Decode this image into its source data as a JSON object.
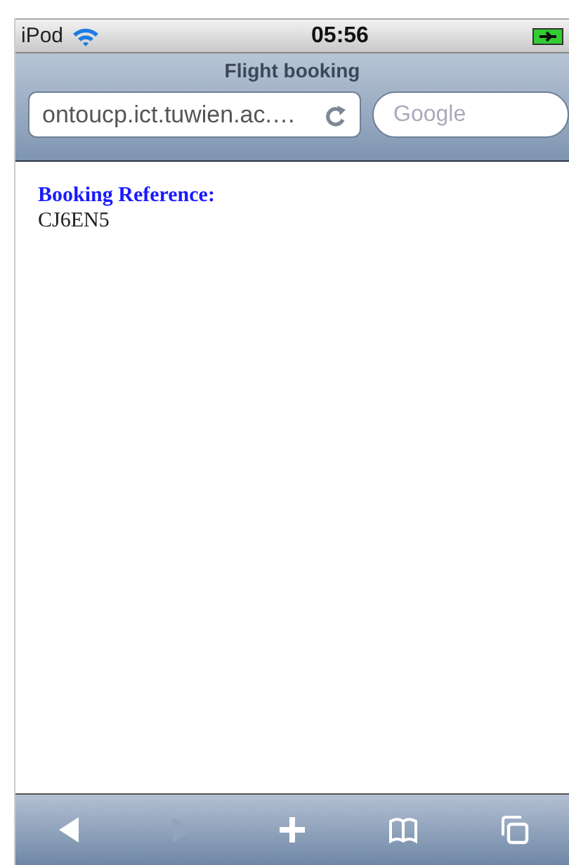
{
  "status_bar": {
    "carrier": "iPod",
    "time": "05:56"
  },
  "window": {
    "title": "Flight booking"
  },
  "address_field": {
    "value": "ontoucp.ict.tuwien.ac.…"
  },
  "search": {
    "placeholder": "Google"
  },
  "content": {
    "label": "Booking Reference:",
    "value": "CJ6EN5"
  },
  "toolbar": [
    {
      "kind": "back",
      "disabled": false
    },
    {
      "kind": "forward",
      "disabled": true
    },
    {
      "kind": "add",
      "disabled": false
    },
    {
      "kind": "bookmarks",
      "disabled": false
    },
    {
      "kind": "pages",
      "disabled": false
    }
  ]
}
